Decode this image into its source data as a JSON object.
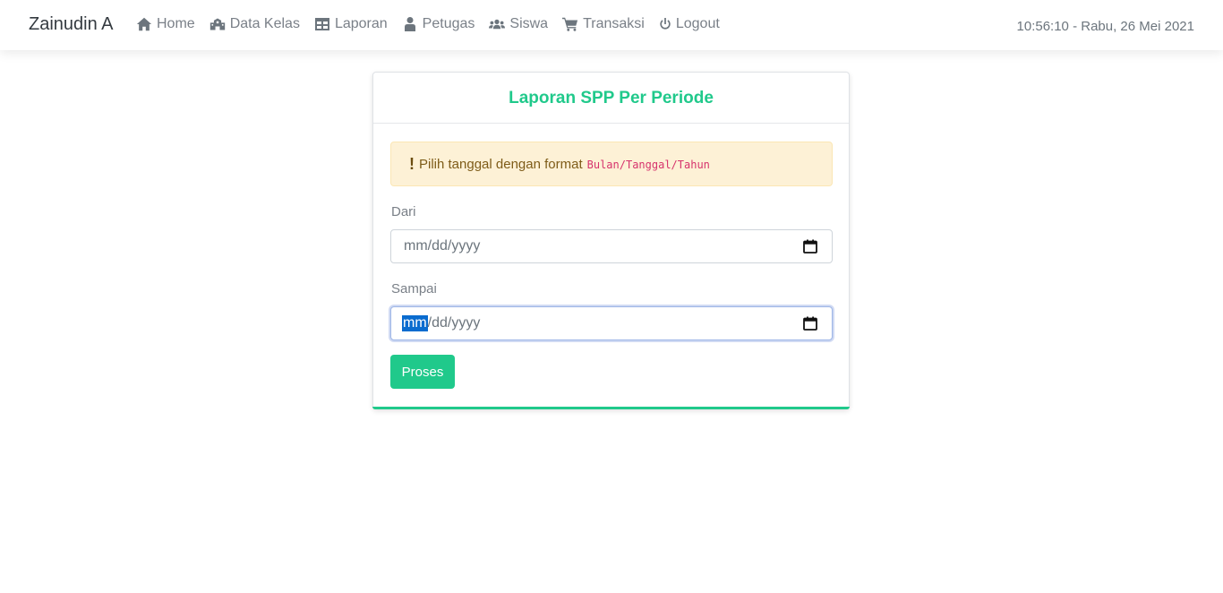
{
  "navbar": {
    "brand": "Zainudin A",
    "items": [
      {
        "label": "Home",
        "icon": "home-icon"
      },
      {
        "label": "Data Kelas",
        "icon": "school-icon"
      },
      {
        "label": "Laporan",
        "icon": "table-icon"
      },
      {
        "label": "Petugas",
        "icon": "user-icon"
      },
      {
        "label": "Siswa",
        "icon": "users-icon"
      },
      {
        "label": "Transaksi",
        "icon": "cart-icon"
      },
      {
        "label": "Logout",
        "icon": "power-icon"
      }
    ],
    "clock": "10:56:10 - Rabu, 26 Mei 2021"
  },
  "card": {
    "title": "Laporan SPP Per Periode",
    "alert": {
      "icon": "!",
      "text": "Pilih tanggal dengan format",
      "code": "Bulan/Tanggal/Tahun"
    },
    "from": {
      "label": "Dari",
      "placeholder": "mm/dd/yyyy"
    },
    "to": {
      "label": "Sampai",
      "placeholder_selected": "mm",
      "placeholder_rest": "/dd/yyyy"
    },
    "submit_label": "Proses"
  },
  "colors": {
    "accent": "#20c98b",
    "alert_bg": "#fdf1d6",
    "selection": "#0a6ccf"
  }
}
